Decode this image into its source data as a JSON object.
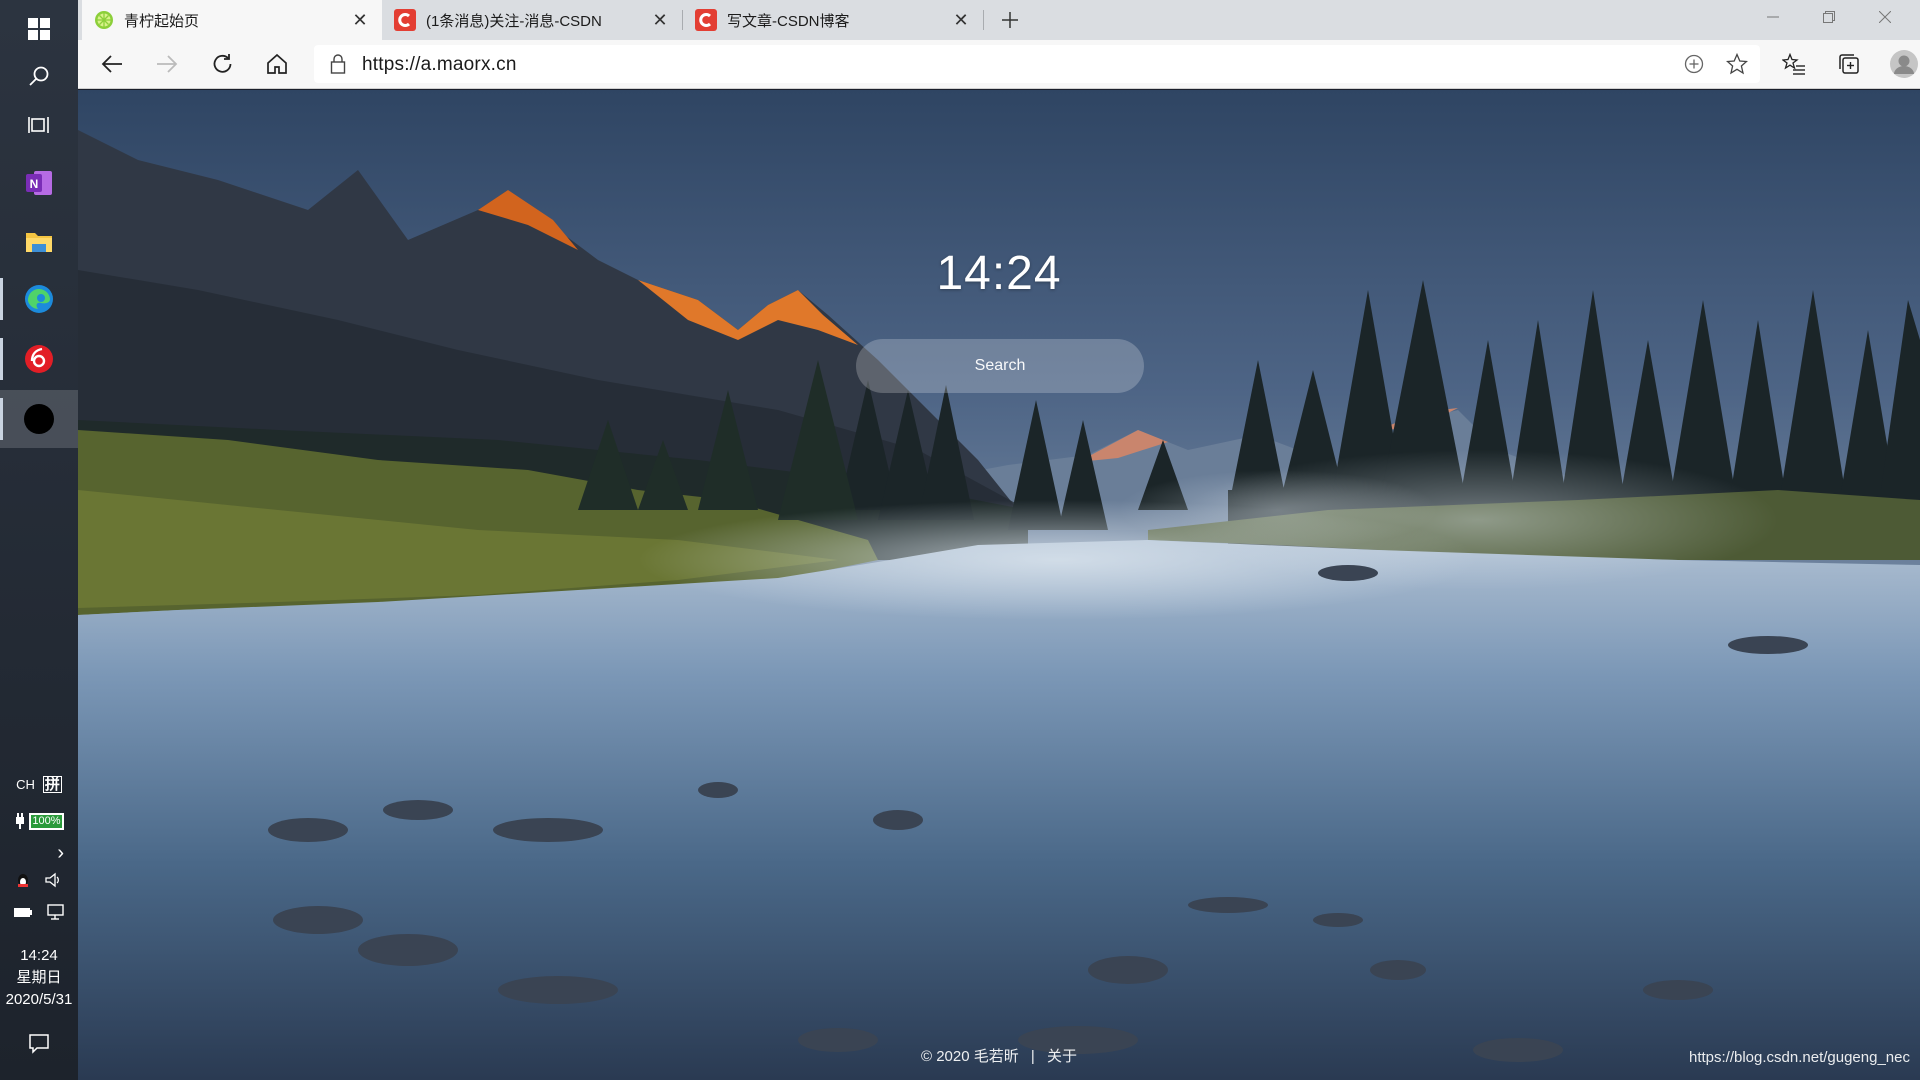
{
  "taskbar": {
    "apps": [
      {
        "name": "start",
        "icon": "windows-logo-icon"
      },
      {
        "name": "search",
        "icon": "search-icon"
      },
      {
        "name": "task-view",
        "icon": "task-view-icon"
      },
      {
        "name": "onenote",
        "icon": "onenote-icon"
      },
      {
        "name": "file-explorer",
        "icon": "folder-icon"
      },
      {
        "name": "edge",
        "icon": "edge-icon"
      },
      {
        "name": "netease-music",
        "icon": "music-icon"
      },
      {
        "name": "unknown-app",
        "icon": "black-circle-icon"
      }
    ],
    "tray": {
      "ime_label": "CH",
      "ime_mode": "拼",
      "battery": "100%",
      "time": "14:24",
      "weekday": "星期日",
      "date": "2020/5/31"
    }
  },
  "browser": {
    "tabs": [
      {
        "title": "青柠起始页",
        "icon": "lime-icon",
        "active": true
      },
      {
        "title": "(1条消息)关注-消息-CSDN",
        "icon": "csdn-icon",
        "active": false
      },
      {
        "title": "写文章-CSDN博客",
        "icon": "csdn-icon",
        "active": false
      }
    ],
    "url": "https://a.maorx.cn"
  },
  "page": {
    "clock": "14:24",
    "search_placeholder": "Search",
    "footer_copyright": "© 2020 毛若昕",
    "footer_separator": "|",
    "footer_about": "关于",
    "watermark": "https://blog.csdn.net/gugeng_nec"
  },
  "colors": {
    "taskbar_bg": "#232a34",
    "tabstrip_bg": "#dadde1",
    "active_tab_bg": "#f7f7f7",
    "csdn_red": "#e33e33",
    "edge_blue": "#1c8adb",
    "onenote_purple": "#7a2db6",
    "netease_red": "#e21e26"
  }
}
